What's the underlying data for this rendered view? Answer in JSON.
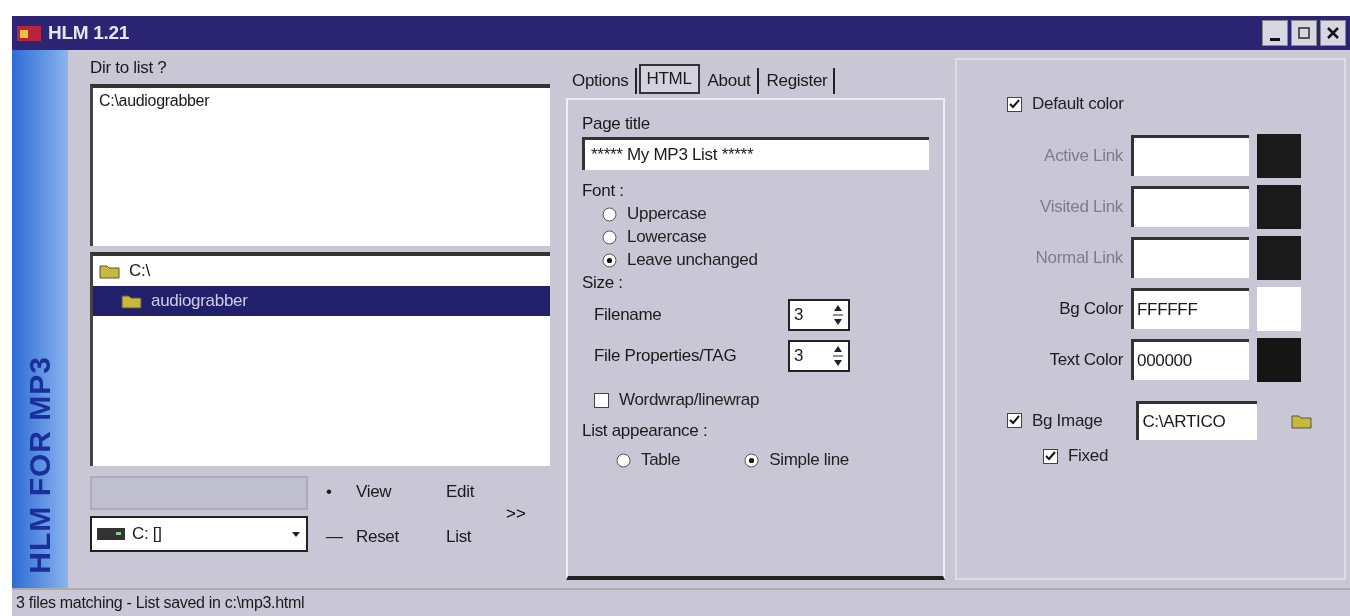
{
  "window": {
    "title": "HLM 1.21"
  },
  "logo": {
    "text": "HLM FOR MP3"
  },
  "dir_panel": {
    "label": "Dir to list ?",
    "dir_list": [
      "C:\\audiograbber"
    ],
    "tree": [
      {
        "label": "C:\\",
        "selected": false,
        "children": [
          {
            "label": "audiograbber",
            "selected": true
          }
        ]
      }
    ],
    "drive": {
      "value": "C: []"
    },
    "actions": [
      [
        "•",
        "View",
        "Edit"
      ],
      [
        "—",
        "Reset",
        "List"
      ]
    ],
    "more_button": ">>"
  },
  "tabs": [
    {
      "label": "Options",
      "selected": false
    },
    {
      "label": "HTML",
      "selected": true
    },
    {
      "label": "About",
      "selected": false
    },
    {
      "label": "Register",
      "selected": false
    }
  ],
  "html_tab": {
    "page_title_label": "Page title",
    "page_title_value": "***** My MP3 List *****",
    "font_label": "Font :",
    "font_options": [
      {
        "label": "Uppercase",
        "selected": false
      },
      {
        "label": "Lowercase",
        "selected": false
      },
      {
        "label": "Leave unchanged",
        "selected": true
      }
    ],
    "size_label": "Size :",
    "sizes": [
      {
        "label": "Filename",
        "value": "3"
      },
      {
        "label": "File Properties/TAG",
        "value": "3"
      }
    ],
    "wordwrap": {
      "label": "Wordwrap/linewrap",
      "checked": false
    },
    "appearance_label": "List appearance :",
    "appearance_options": [
      {
        "label": "Table",
        "selected": false
      },
      {
        "label": "Simple line",
        "selected": true
      }
    ]
  },
  "colors": {
    "default_color": {
      "label": "Default color",
      "checked": true
    },
    "rows": [
      {
        "label": "Active Link",
        "disabled": true,
        "color": "#1a1a1a"
      },
      {
        "label": "Visited Link",
        "disabled": true,
        "color": "#1a1a1a"
      },
      {
        "label": "Normal Link",
        "disabled": true,
        "color": "#1a1a1a"
      },
      {
        "label": "Bg Color",
        "value": "FFFFFF",
        "disabled": false,
        "color": "#ffffff"
      },
      {
        "label": "Text Color",
        "value": "000000",
        "disabled": false,
        "color": "#151515"
      }
    ],
    "bg_image": {
      "label": "Bg Image",
      "checked": true,
      "value": "C:\\ARTICO"
    },
    "fixed": {
      "label": "Fixed",
      "checked": true
    }
  },
  "status_bar": {
    "text": "3 files matching - List saved in c:\\mp3.html"
  }
}
